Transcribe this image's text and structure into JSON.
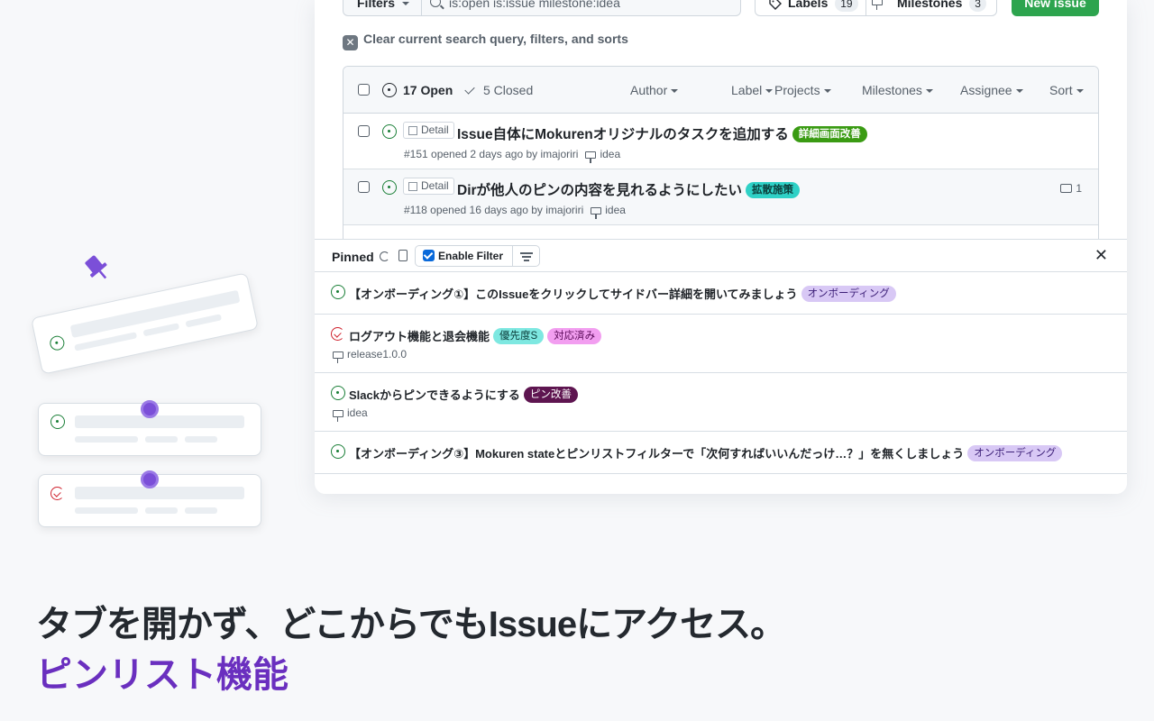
{
  "toolbar": {
    "filters_label": "Filters",
    "search_value": "is:open is:issue milestone:idea",
    "labels_label": "Labels",
    "labels_count": "19",
    "milestones_label": "Milestones",
    "milestones_count": "3",
    "new_issue_label": "New issue",
    "clear_label": "Clear current search query, filters, and sorts"
  },
  "issues_header": {
    "open": "17 Open",
    "closed": "5 Closed",
    "filters": [
      "Author",
      "Label",
      "Projects",
      "Milestones",
      "Assignee",
      "Sort"
    ]
  },
  "issues": [
    {
      "tag": "Detail",
      "title": "Issue自体にMokurenオリジナルのタスクを追加する",
      "label": "詳細画面改善",
      "label_bg": "#3a9b13",
      "label_fg": "#ffffff",
      "meta": "#151 opened 2 days ago by imajoriri",
      "milestone": "idea",
      "comments": ""
    },
    {
      "tag": "Detail",
      "title": "Dirが他人のピンの内容を見れるようにしたい",
      "label": "拡散施策",
      "label_bg": "#2fd1c6",
      "label_fg": "#0b3d3a",
      "meta": "#118 opened 16 days ago by imajoriri",
      "milestone": "idea",
      "comments": "1"
    }
  ],
  "pinned": {
    "title": "Pinned",
    "enable_filter_label": "Enable Filter",
    "items": [
      {
        "status": "open",
        "title": "【オンボーディング①】このIssueをクリックしてサイドバー詳細を開いてみましょう",
        "labels": [
          {
            "text": "オンボーディング",
            "bg": "#d8c8f5",
            "fg": "#3c1f78"
          }
        ],
        "milestone": ""
      },
      {
        "status": "closed",
        "title": "ログアウト機能と退会機能",
        "labels": [
          {
            "text": "優先度S",
            "bg": "#7ee8e1",
            "fg": "#0b3d3a"
          },
          {
            "text": "対応済み",
            "bg": "#f29ef0",
            "fg": "#5a0a58"
          }
        ],
        "milestone": "release1.0.0"
      },
      {
        "status": "open",
        "title": "Slackからピンできるようにする",
        "labels": [
          {
            "text": "ピン改善",
            "bg": "#5e1550",
            "fg": "#ffffff"
          }
        ],
        "milestone": "idea"
      },
      {
        "status": "open",
        "title": "【オンボーディング③】Mokuren stateとピンリストフィルターで「次何すればいいんだっけ…？」を無くしましょう",
        "labels": [
          {
            "text": "オンボーディング",
            "bg": "#d8c8f5",
            "fg": "#3c1f78"
          }
        ],
        "milestone": ""
      }
    ]
  },
  "headline": "タブを開かず、どこからでもIssueにアクセス。",
  "subheadline": "ピンリスト機能",
  "colors": {
    "accent_purple": "#6a2fbf",
    "github_green": "#2da44e",
    "open_icon_green": "#1a7f37",
    "closed_icon_red": "#cf222e"
  }
}
